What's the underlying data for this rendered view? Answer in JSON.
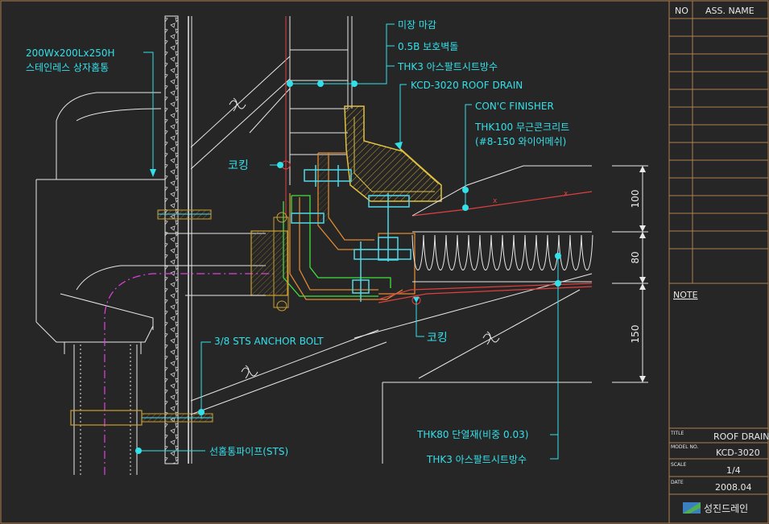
{
  "labels": {
    "finish": "미장 마감",
    "protect_wall": "0.5B 보호벽돌",
    "asphalt_top": "THK3 아스팔트시트방수",
    "roof_drain": "KCD-3020 ROOF DRAIN",
    "conc_finisher": "CON'C FINISHER",
    "plain_concrete": "THK100 무근콘크리트",
    "wire_mesh": "(#8-150 와이어메쉬)",
    "box_gutter_line1": "200Wx200Lx250H",
    "box_gutter_line2": "스테인레스 상자홈통",
    "caulking_left": "코킹",
    "caulking_bottom": "코킹",
    "anchor_bolt": "3/8 STS ANCHOR BOLT",
    "pipe": "선홈통파이프(STS)",
    "insulation": "THK80 단열재(비중 0.03)",
    "asphalt_bottom": "THK3 아스팔트시트방수"
  },
  "dimensions": [
    "100",
    "80",
    "150"
  ],
  "title_block": {
    "col_no": "NO",
    "col_name": "ASS. NAME",
    "note_label": "NOTE",
    "title_label": "TITLE",
    "title_value": "ROOF DRAIN",
    "model_label": "MODEL NO.",
    "model_value": "KCD-3020",
    "scale_label": "SCALE",
    "scale_value": "1/4",
    "date_label": "DATE",
    "date_value": "2008.04",
    "company": "성진드레인"
  },
  "colors": {
    "background": "#262626",
    "leader": "#33e0ea",
    "drain_yellow": "#e0c040",
    "pipe_green": "#40e040",
    "drain_orange": "#e08a30",
    "bolt_cyan": "#50d8e8",
    "membrane_red": "#e04040",
    "pipe_magenta": "#e040e0",
    "border_brown": "#b08050"
  }
}
